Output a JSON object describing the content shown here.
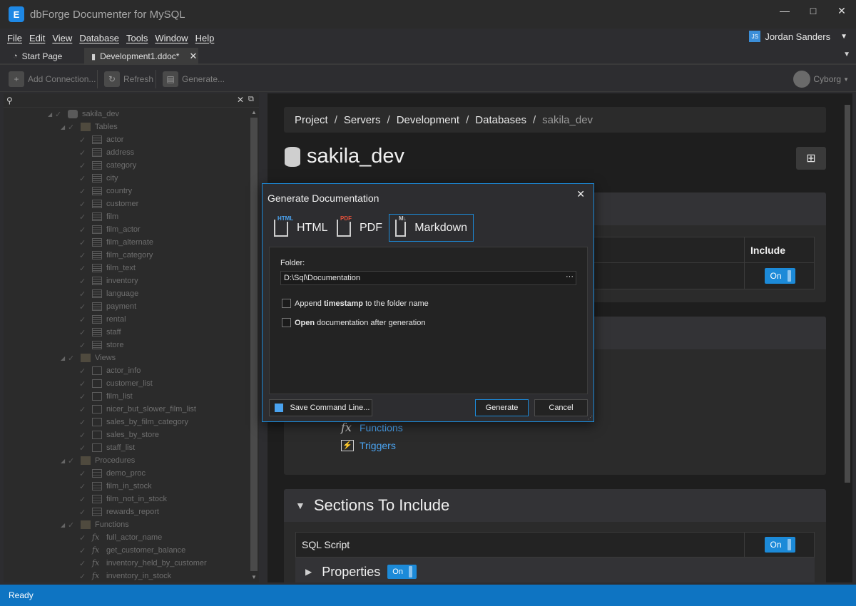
{
  "app": {
    "title": "dbForge Documenter for MySQL",
    "logo_glyph": "E"
  },
  "window_controls": {
    "minimize": "—",
    "maximize": "□",
    "close": "✕"
  },
  "menu": [
    "File",
    "Edit",
    "View",
    "Database",
    "Tools",
    "Window",
    "Help"
  ],
  "user": {
    "initials": "JS",
    "name": "Jordan Sanders"
  },
  "tabs": [
    {
      "label": "Start Page",
      "icon": "start-page-icon"
    },
    {
      "label": "Development1.ddoc*",
      "icon": "document-icon"
    }
  ],
  "toolbar": {
    "add_connection": "Add Connection...",
    "refresh": "Refresh",
    "generate": "Generate...",
    "theme": "Cyborg"
  },
  "tree": {
    "root": "sakila_dev",
    "folders": {
      "tables": "Tables",
      "views": "Views",
      "procedures": "Procedures",
      "functions": "Functions"
    },
    "tables": [
      "actor",
      "address",
      "category",
      "city",
      "country",
      "customer",
      "film",
      "film_actor",
      "film_alternate",
      "film_category",
      "film_text",
      "inventory",
      "language",
      "payment",
      "rental",
      "staff",
      "store"
    ],
    "views": [
      "actor_info",
      "customer_list",
      "film_list",
      "nicer_but_slower_film_list",
      "sales_by_film_category",
      "sales_by_store",
      "staff_list"
    ],
    "procedures": [
      "demo_proc",
      "film_in_stock",
      "film_not_in_stock",
      "rewards_report"
    ],
    "functions": [
      "full_actor_name",
      "get_customer_balance",
      "inventory_held_by_customer",
      "inventory_in_stock"
    ]
  },
  "breadcrumb": {
    "items": [
      "Project",
      "Servers",
      "Development",
      "Databases"
    ],
    "current": "sakila_dev",
    "separator": "/"
  },
  "page_title": "sakila_dev",
  "include_table": {
    "column": "Include",
    "toggle": "On"
  },
  "objects": {
    "functions": "Functions",
    "triggers": "Triggers",
    "fx_glyph": "fx",
    "trig_glyph": "⚡"
  },
  "sections": {
    "title": "Sections To Include",
    "sql_script": "SQL Script",
    "sql_toggle": "On",
    "properties": "Properties",
    "properties_toggle": "On"
  },
  "dialog": {
    "title": "Generate Documentation",
    "formats": [
      {
        "label": "HTML",
        "tag": "HTML",
        "color": "#4aa3f0"
      },
      {
        "label": "PDF",
        "tag": "PDF",
        "color": "#e0503a"
      },
      {
        "label": "Markdown",
        "tag": "M↓",
        "color": "#cfcfcf"
      }
    ],
    "selected_format": "Markdown",
    "folder_label": "Folder:",
    "folder_value": "D:\\Sql\\Documentation",
    "browse": "···",
    "append_pre": "Append ",
    "append_bold": "timestamp",
    "append_post": " to the folder name",
    "open_bold": "Open",
    "open_post": " documentation after generation",
    "save_cmd": "Save Command Line...",
    "generate": "Generate",
    "cancel": "Cancel"
  },
  "status": "Ready"
}
